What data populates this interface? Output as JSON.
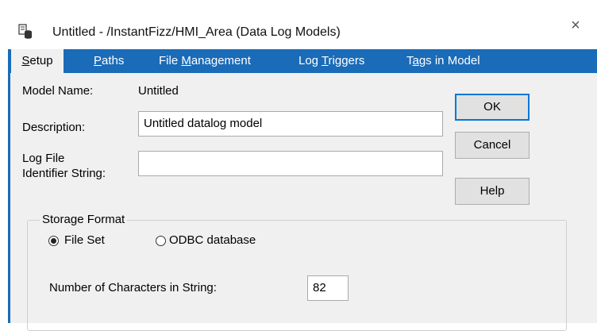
{
  "window": {
    "title": "Untitled - /InstantFizz/HMI_Area (Data Log Models)",
    "close_glyph": "×",
    "icon": "datalog-app-icon"
  },
  "tabs": [
    {
      "label_pre": "",
      "mnemonic": "S",
      "label_post": "etup",
      "active": true
    },
    {
      "label_pre": "",
      "mnemonic": "P",
      "label_post": "aths",
      "active": false
    },
    {
      "label_pre": "File ",
      "mnemonic": "M",
      "label_post": "anagement",
      "active": false
    },
    {
      "label_pre": "Log ",
      "mnemonic": "T",
      "label_post": "riggers",
      "active": false
    },
    {
      "label_pre": "T",
      "mnemonic": "a",
      "label_post": "gs in Model",
      "active": false
    }
  ],
  "setup": {
    "model_name_label": "Model Name:",
    "model_name_value": "Untitled",
    "description_label": "Description:",
    "description_value": "Untitled datalog model",
    "log_file_label_line1": "Log File",
    "log_file_label_line2": "Identifier String:",
    "log_file_value": ""
  },
  "buttons": {
    "ok": "OK",
    "cancel": "Cancel",
    "help": "Help"
  },
  "storage": {
    "group_title": "Storage Format",
    "option_file_set": "File Set",
    "option_odbc": "ODBC database",
    "selected": "File Set",
    "num_chars_label": "Number of Characters in String:",
    "num_chars_value": "82"
  },
  "colors": {
    "tab_bar": "#1a6bb8",
    "panel": "#f0f0f0",
    "default_button_border": "#0078d7"
  }
}
